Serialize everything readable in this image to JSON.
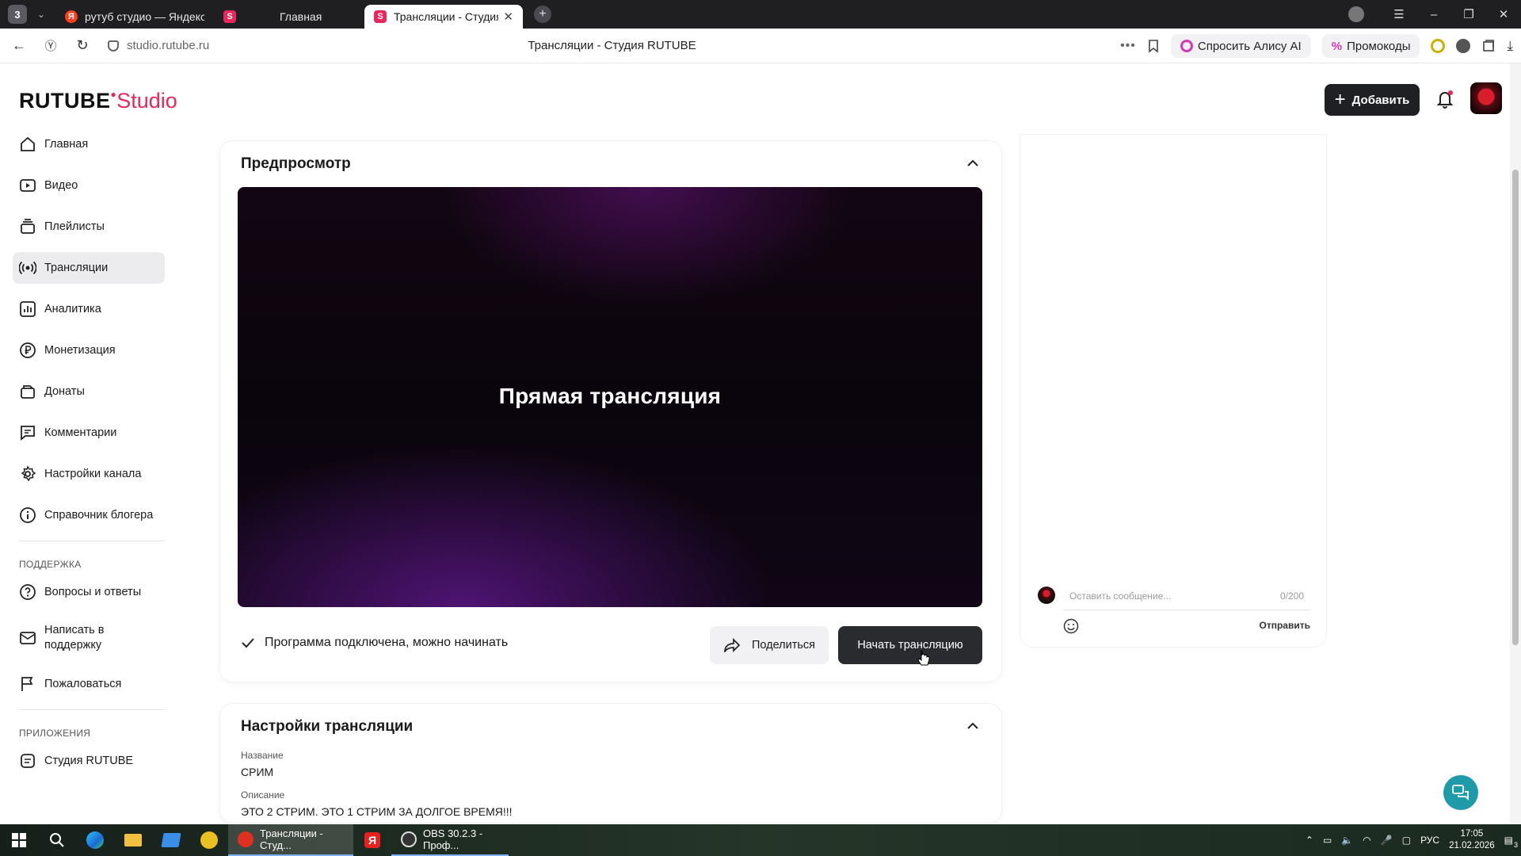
{
  "browser": {
    "tab_count": "3",
    "tabs": [
      {
        "title": "рутуб студио — Яндекс: н",
        "favicon": "yandex-icon",
        "active": false
      },
      {
        "title": "Главная",
        "favicon": "rutube-studio-icon",
        "active": false
      },
      {
        "title": "Трансляции - Студия R",
        "favicon": "rutube-studio-icon",
        "active": true
      }
    ],
    "url": "studio.rutube.ru",
    "page_title": "Трансляции - Студия RUTUBE",
    "ask_alice": "Спросить Алису AI",
    "promo": "Промокоды"
  },
  "header": {
    "logo_main": "RUTUBE",
    "logo_sub": "Studio",
    "add_button": "Добавить"
  },
  "sidebar": {
    "items": [
      {
        "label": "Главная",
        "icon": "home-icon"
      },
      {
        "label": "Видео",
        "icon": "video-icon"
      },
      {
        "label": "Плейлисты",
        "icon": "playlist-icon"
      },
      {
        "label": "Трансляции",
        "icon": "broadcast-icon",
        "active": true
      },
      {
        "label": "Аналитика",
        "icon": "analytics-icon"
      },
      {
        "label": "Монетизация",
        "icon": "ruble-icon"
      },
      {
        "label": "Донаты",
        "icon": "donate-icon"
      },
      {
        "label": "Комментарии",
        "icon": "comments-icon"
      },
      {
        "label": "Настройки канала",
        "icon": "gear-icon"
      },
      {
        "label": "Справочник блогера",
        "icon": "info-icon"
      }
    ],
    "support_heading": "ПОДДЕРЖКА",
    "support_items": [
      {
        "label": "Вопросы и ответы",
        "icon": "question-icon"
      },
      {
        "label": "Написать в поддержку",
        "icon": "mail-icon"
      },
      {
        "label": "Пожаловаться",
        "icon": "flag-icon"
      }
    ],
    "apps_heading": "ПРИЛОЖЕНИЯ",
    "apps_items": [
      {
        "label": "Студия RUTUBE",
        "icon": "studio-app-icon"
      }
    ]
  },
  "preview": {
    "title": "Предпросмотр",
    "video_label": "Прямая трансляция",
    "status": "Программа подключена, можно начинать",
    "share_button": "Поделиться",
    "start_button": "Начать трансляцию"
  },
  "settings": {
    "title": "Настройки трансляции",
    "name_label": "Название",
    "name_value": "СРИМ",
    "description_label": "Описание",
    "description_value": "ЭТО 2 СТРИМ. ЭТО 1 СТРИМ ЗА ДОЛГОЕ ВРЕМЯ!!!"
  },
  "chat": {
    "placeholder": "Оставить сообщение...",
    "counter": "0/200",
    "send": "Отправить"
  },
  "taskbar": {
    "apps": [
      {
        "label": "Трансляции - Студ..."
      },
      {
        "label": "OBS 30.2.3 - Проф..."
      }
    ],
    "lang": "РУС",
    "time": "17:05",
    "date": "21.02.2026",
    "notifications": "3"
  },
  "colors": {
    "accent": "#e8275a",
    "dark_button": "#2a2b2f",
    "help_fab": "#1f9aa8"
  }
}
